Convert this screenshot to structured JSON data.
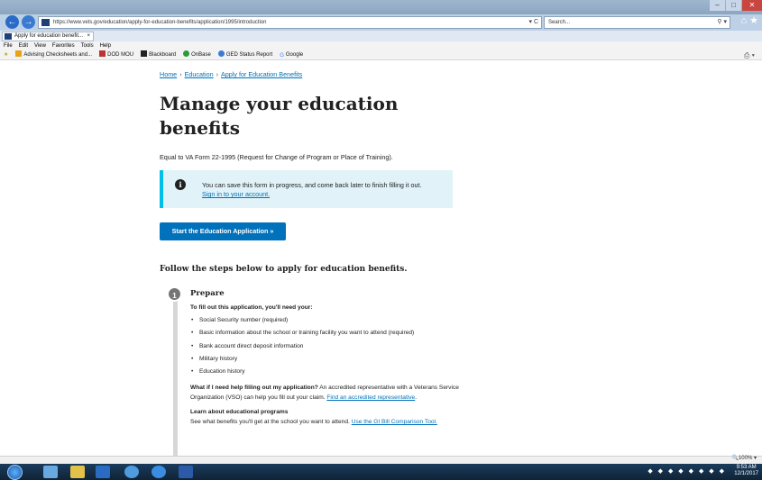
{
  "browser": {
    "url": "https://www.vets.gov/education/apply-for-education-benefits/application/1995/introduction",
    "search_placeholder": "Search...",
    "tab_title": "Apply for education benefit...",
    "tab_close": "×",
    "menu": [
      "File",
      "Edit",
      "View",
      "Favorites",
      "Tools",
      "Help"
    ],
    "favorites": [
      "Advising Checksheets and...",
      "DOD MOU",
      "Blackboard",
      "OnBase",
      "GED Status Report",
      "Google"
    ],
    "zoom": "100%",
    "clock_time": "9:53 AM",
    "clock_date": "12/1/2017"
  },
  "breadcrumb": {
    "home": "Home",
    "education": "Education",
    "current": "Apply for Education Benefits",
    "sep": "›"
  },
  "page": {
    "title": "Manage your education benefits",
    "subtitle": "Equal to VA Form 22-1995 (Request for Change of Program or Place of Training).",
    "alert_text": "You can save this form in progress, and come back later to finish filling it out.",
    "alert_link": "Sign in to your account.",
    "start_button": "Start the Education Application »",
    "steps_heading": "Follow the steps below to apply for education benefits."
  },
  "step1": {
    "number": "1",
    "title": "Prepare",
    "need_label": "To fill out this application, you'll need your:",
    "items": [
      "Social Security number (required)",
      "Basic information about the school or training facility you want to attend (required)",
      "Bank account direct deposit information",
      "Military history",
      "Education history"
    ],
    "help_q": "What if I need help filling out my application?",
    "help_text": " An accredited representative with a Veterans Service Organization (VSO) can help you fill out your claim. ",
    "help_link": "Find an accredited representative",
    "help_end": ".",
    "learn_heading": "Learn about educational programs",
    "learn_text": "See what benefits you'll get at the school you want to attend. ",
    "learn_link": "Use the GI Bill Comparison Tool."
  },
  "colors": {
    "link": "#0071bb",
    "alert_bg": "#e1f3f8",
    "alert_border": "#02bfe7",
    "button": "#0071bb"
  }
}
